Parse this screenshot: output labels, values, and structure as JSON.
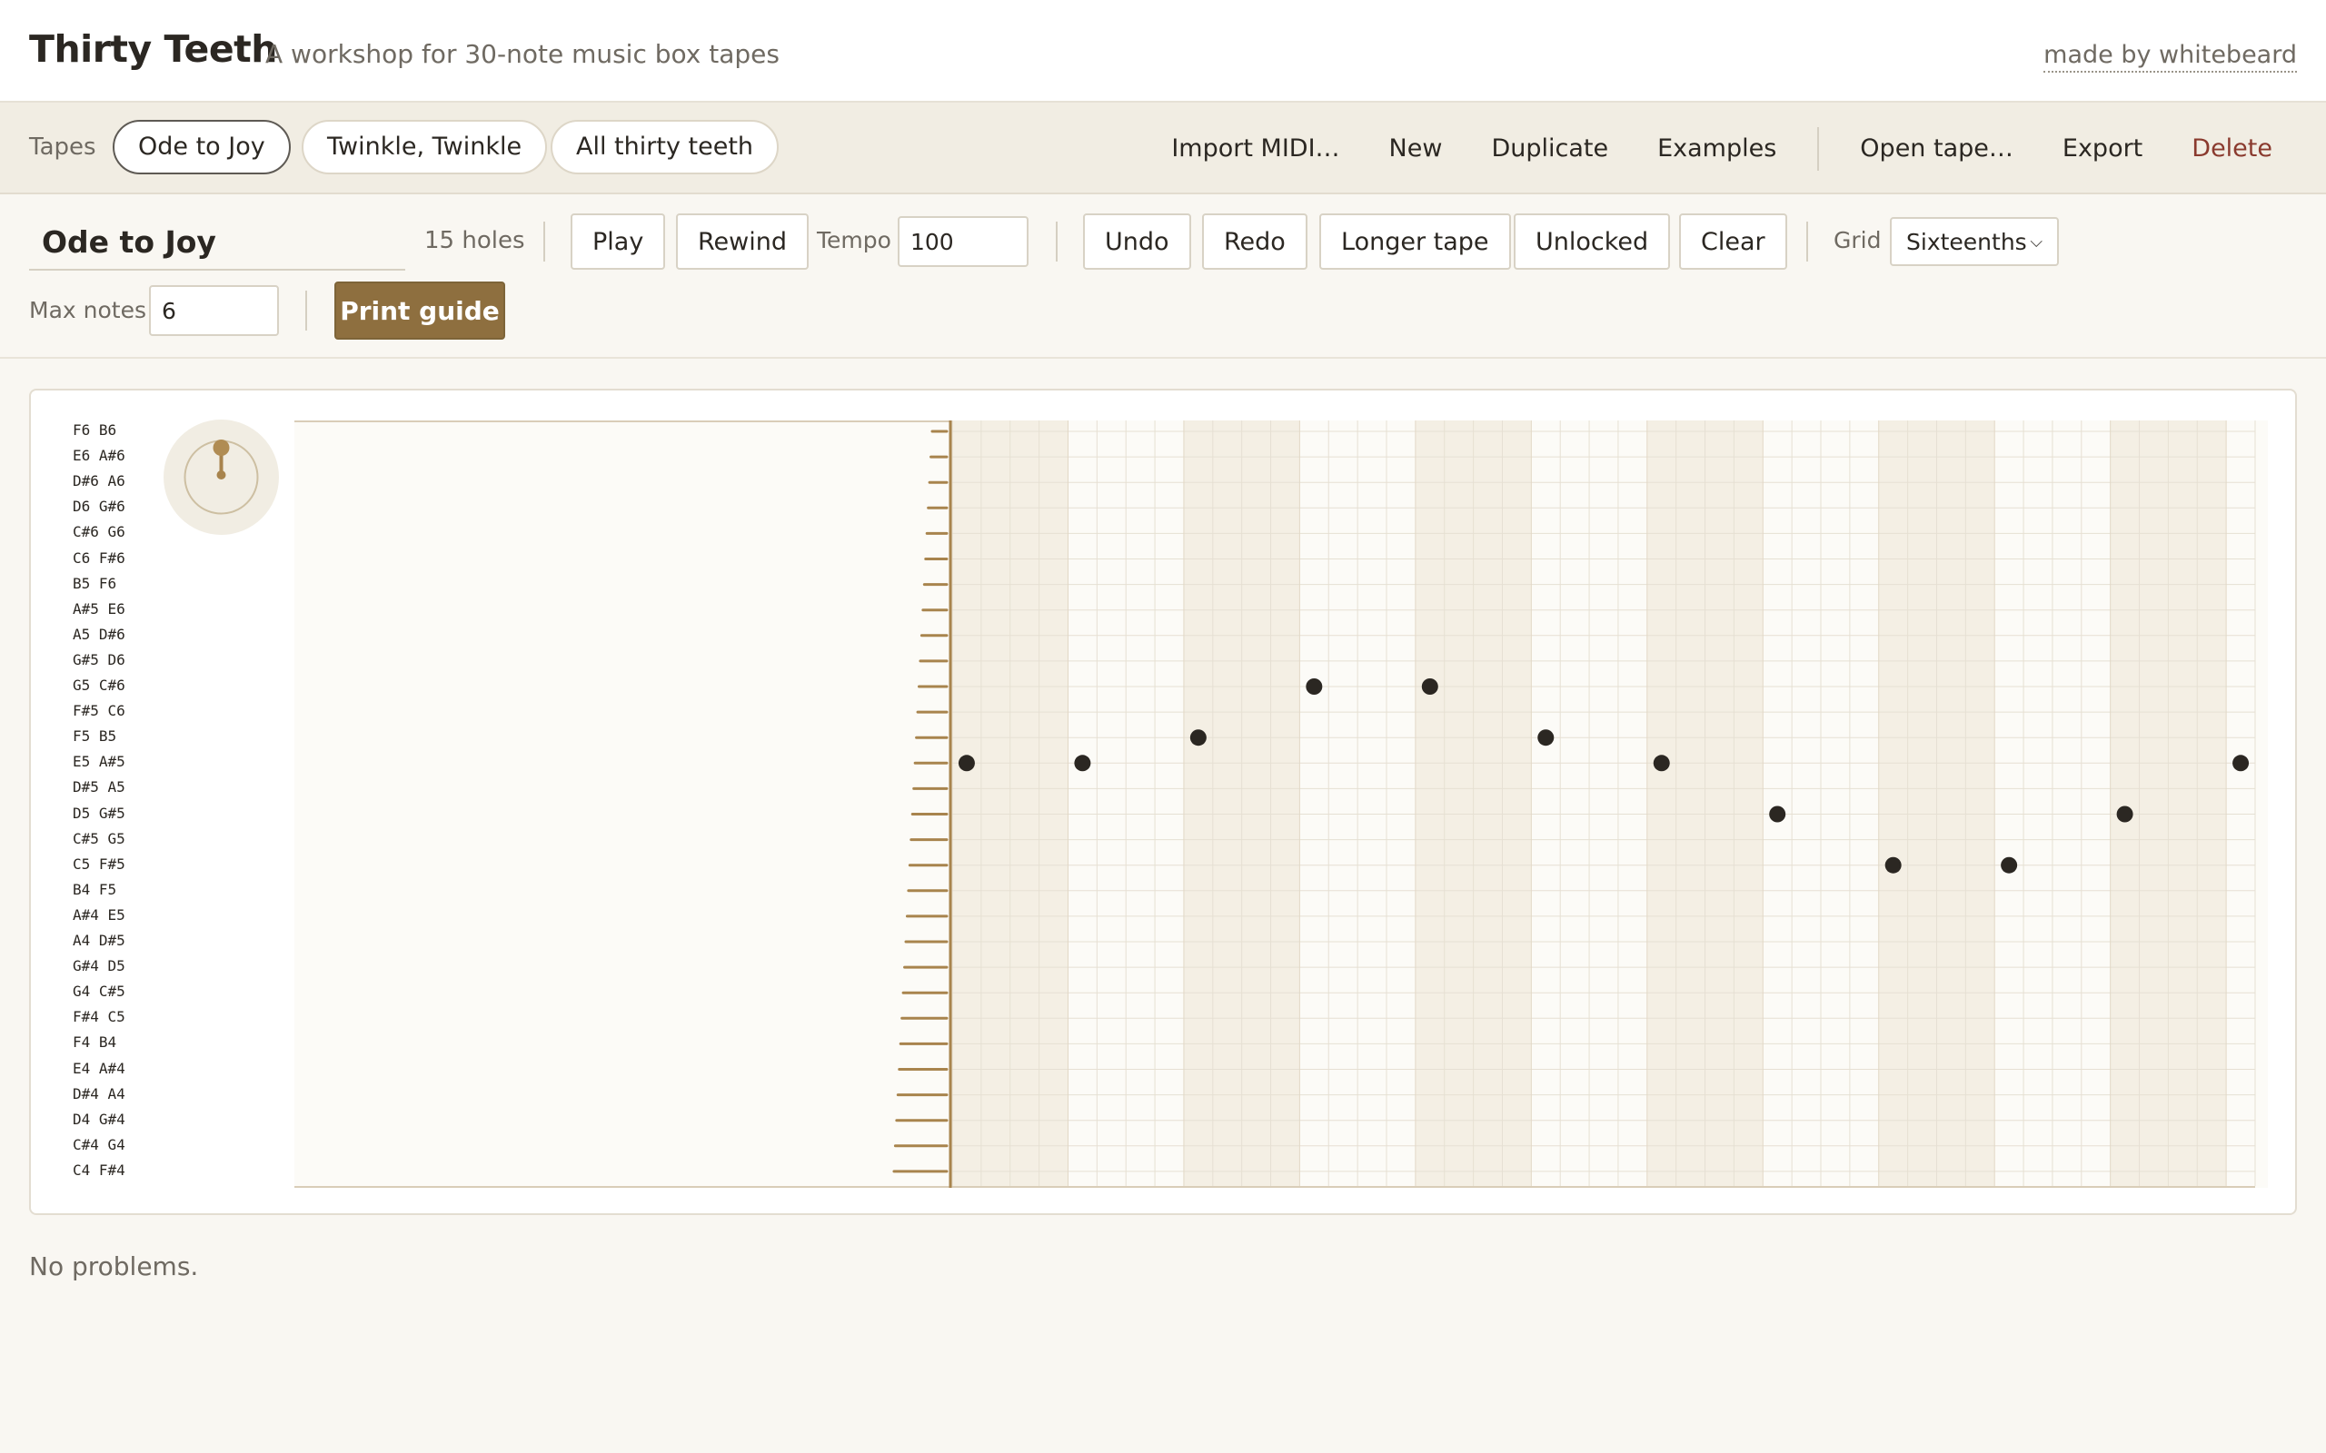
{
  "header": {
    "title": "Thirty Teeth",
    "subtitle": "A workshop for 30-note music box tapes",
    "made_by": "made by whitebeard"
  },
  "tapes": {
    "label": "Tapes",
    "items": [
      {
        "label": "Ode to Joy",
        "active": true
      },
      {
        "label": "Twinkle, Twinkle",
        "active": false
      },
      {
        "label": "All thirty teeth",
        "active": false
      }
    ],
    "actions": {
      "import_midi": "Import MIDI…",
      "new": "New",
      "duplicate": "Duplicate",
      "examples": "Examples",
      "open_tape": "Open tape…",
      "export": "Export",
      "delete": "Delete"
    }
  },
  "toolbar": {
    "tape_name": "Ode to Joy",
    "holes": "15 holes",
    "play": "Play",
    "rewind": "Rewind",
    "tempo_label": "Tempo",
    "tempo_value": "100",
    "undo": "Undo",
    "redo": "Redo",
    "longer_tape": "Longer tape",
    "unlocked": "Unlocked",
    "clear": "Clear",
    "grid_label": "Grid",
    "grid_value": "Sixteenths",
    "max_notes_label": "Max notes",
    "max_notes_value": "6",
    "print_guide": "Print guide"
  },
  "editor": {
    "note_labels": [
      "F6 B6",
      "E6 A#6",
      "D#6 A6",
      "D6 G#6",
      "C#6 G6",
      "C6 F#6",
      "B5 F6",
      "A#5 E6",
      "A5 D#6",
      "G#5 D6",
      "G5 C#6",
      "F#5 C6",
      "F5 B5",
      "E5 A#5",
      "D#5 A5",
      "D5 G#5",
      "C#5 G5",
      "C5 F#5",
      "B4 F5",
      "A#4 E5",
      "A4 D#5",
      "G#4 D5",
      "G4 C#5",
      "F#4 C5",
      "F4 B4",
      "E4 A#4",
      "D#4 A4",
      "D4 G#4",
      "C#4 G4",
      "C4 F#4"
    ],
    "colors": {
      "shaded": "#f4efe4",
      "light": "#fcfbf7",
      "grid_line": "#e6e0d3",
      "accent": "#a8844d",
      "note": "#2b2722"
    },
    "grid": {
      "columns": 45,
      "steps_per_beat": 4
    },
    "notes": [
      {
        "row": 13,
        "step": 0
      },
      {
        "row": 13,
        "step": 4
      },
      {
        "row": 12,
        "step": 8
      },
      {
        "row": 10,
        "step": 12
      },
      {
        "row": 10,
        "step": 16
      },
      {
        "row": 12,
        "step": 20
      },
      {
        "row": 13,
        "step": 24
      },
      {
        "row": 15,
        "step": 28
      },
      {
        "row": 17,
        "step": 32
      },
      {
        "row": 17,
        "step": 36
      },
      {
        "row": 15,
        "step": 40
      },
      {
        "row": 13,
        "step": 44
      }
    ]
  },
  "status": "No problems."
}
